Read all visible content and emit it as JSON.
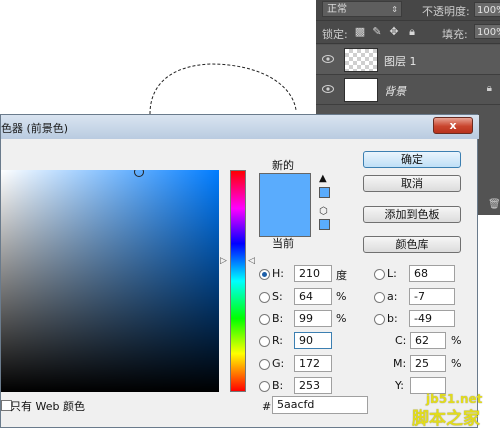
{
  "layers_panel": {
    "blend_mode": "正常",
    "opacity_label": "不透明度:",
    "opacity_value": "100%",
    "lock_label": "锁定:",
    "fill_label": "填充:",
    "fill_value": "100%",
    "layers": [
      {
        "name": "图层 1",
        "thumbnail": "transparent-checker",
        "selected": true
      },
      {
        "name": "背景",
        "thumbnail": "white",
        "locked": true
      }
    ]
  },
  "dialog": {
    "title": "色器 (前景色)",
    "close_label": "x",
    "new_label": "新的",
    "current_label": "当前",
    "buttons": {
      "ok": "确定",
      "cancel": "取消",
      "add_swatch": "添加到色板",
      "libraries": "颜色库"
    },
    "fields": {
      "H": {
        "label": "H:",
        "value": "210",
        "unit": "度"
      },
      "S": {
        "label": "S:",
        "value": "64",
        "unit": "%"
      },
      "B": {
        "label": "B:",
        "value": "99",
        "unit": "%"
      },
      "R": {
        "label": "R:",
        "value": "90"
      },
      "G": {
        "label": "G:",
        "value": "172"
      },
      "Bb": {
        "label": "B:",
        "value": "253"
      },
      "L": {
        "label": "L:",
        "value": "68"
      },
      "a": {
        "label": "a:",
        "value": "-7"
      },
      "b": {
        "label": "b:",
        "value": "-49"
      },
      "C": {
        "label": "C:",
        "value": "62",
        "unit": "%"
      },
      "M": {
        "label": "M:",
        "value": "25",
        "unit": "%"
      },
      "Y": {
        "label": "Y:",
        "value": ""
      }
    },
    "web_only_label": "只有 Web 颜色",
    "hex_label": "#",
    "hex_value": "5aacfd",
    "new_color": "#5aacfd",
    "current_color": "#5aacfd"
  },
  "watermark": {
    "line1": "jb51.net",
    "line2": "脚本之家"
  },
  "colors": {
    "panel_bg": "#535353",
    "dialog_bg": "#f0f0f0",
    "selected_color": "#5aacfd"
  }
}
